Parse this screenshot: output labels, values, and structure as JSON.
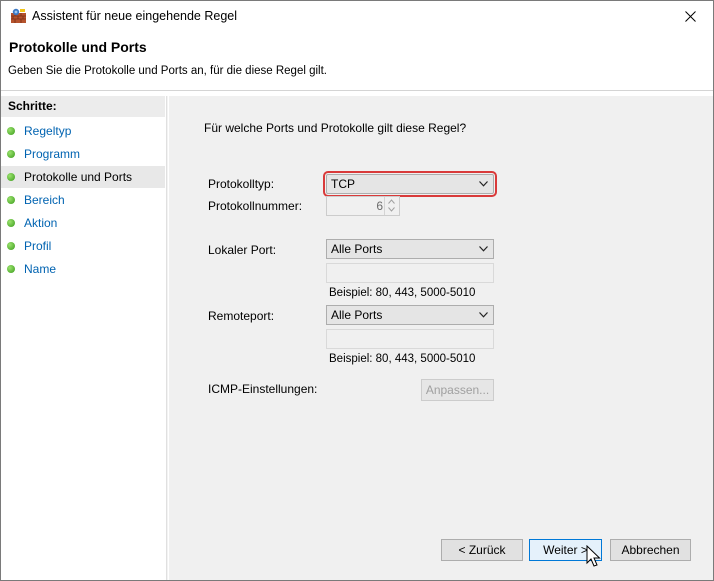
{
  "window": {
    "title": "Assistent für neue eingehende Regel"
  },
  "header": {
    "title": "Protokolle und Ports",
    "description": "Geben Sie die Protokolle und Ports an, für die diese Regel gilt."
  },
  "sidebar": {
    "title": "Schritte:",
    "steps": [
      {
        "label": "Regeltyp"
      },
      {
        "label": "Programm"
      },
      {
        "label": "Protokolle und Ports",
        "current": true
      },
      {
        "label": "Bereich"
      },
      {
        "label": "Aktion"
      },
      {
        "label": "Profil"
      },
      {
        "label": "Name"
      }
    ]
  },
  "main": {
    "question": "Für welche Ports und Protokolle gilt diese Regel?",
    "protocol_type": {
      "label": "Protokolltyp:",
      "value": "TCP"
    },
    "protocol_number": {
      "label": "Protokollnummer:",
      "value": "6"
    },
    "local_port": {
      "label": "Lokaler Port:",
      "value": "Alle Ports",
      "text": "",
      "example": "Beispiel: 80, 443, 5000-5010"
    },
    "remote_port": {
      "label": "Remoteport:",
      "value": "Alle Ports",
      "text": "",
      "example": "Beispiel: 80, 443, 5000-5010"
    },
    "icmp": {
      "label": "ICMP-Einstellungen:",
      "button": "Anpassen..."
    }
  },
  "footer": {
    "back": "< Zurück",
    "next": "Weiter >",
    "cancel": "Abbrechen"
  },
  "colors": {
    "highlight": "#d93a3a",
    "link": "#0063b1",
    "content_bg": "#f0f0f0",
    "step_dot": "#3a9a1c"
  }
}
